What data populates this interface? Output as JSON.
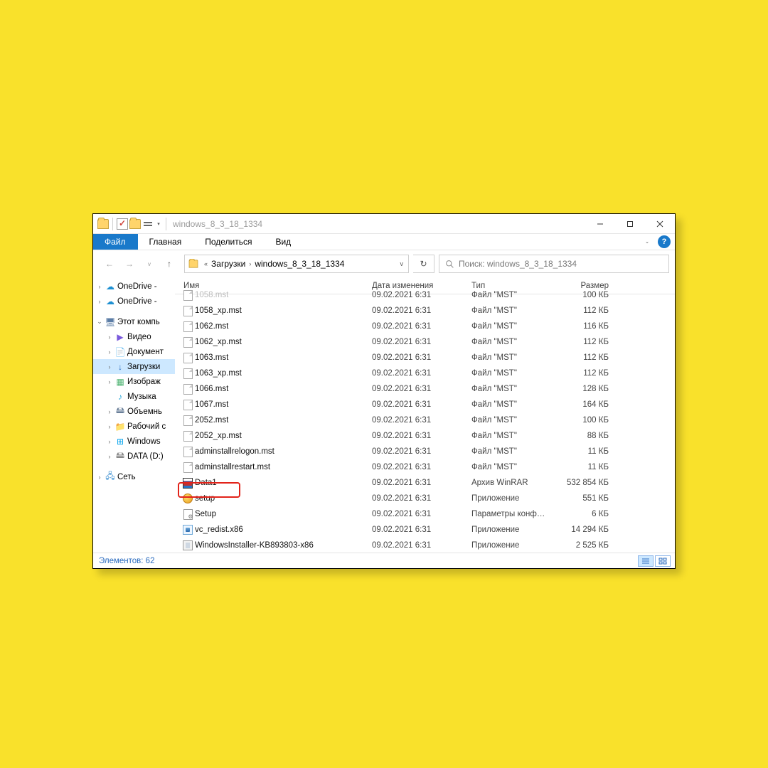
{
  "window": {
    "title": "windows_8_3_18_1334"
  },
  "tabs": {
    "file": "Файл",
    "home": "Главная",
    "share": "Поделиться",
    "view": "Вид"
  },
  "address": {
    "chev": "«",
    "seg1": "Загрузки",
    "seg2": "windows_8_3_18_1334"
  },
  "search": {
    "placeholder": "Поиск: windows_8_3_18_1334"
  },
  "columns": {
    "name": "Имя",
    "date": "Дата изменения",
    "type": "Тип",
    "size": "Размер"
  },
  "sidebar": [
    {
      "label": "OneDrive -",
      "icon": "onedrive",
      "chev": ">",
      "indent": 0
    },
    {
      "label": "OneDrive -",
      "icon": "onedrive",
      "chev": ">",
      "indent": 0
    },
    {
      "label": "Этот компь",
      "icon": "pc",
      "chev": "v",
      "indent": 0
    },
    {
      "label": "Видео",
      "icon": "vid",
      "chev": ">",
      "indent": 1
    },
    {
      "label": "Документ",
      "icon": "doc",
      "chev": ">",
      "indent": 1
    },
    {
      "label": "Загрузки",
      "icon": "arrow",
      "chev": ">",
      "indent": 1,
      "selected": true
    },
    {
      "label": "Изображ",
      "icon": "img",
      "chev": ">",
      "indent": 1
    },
    {
      "label": "Музыка",
      "icon": "music",
      "chev": "",
      "indent": 1
    },
    {
      "label": "Объемнь",
      "icon": "vol",
      "chev": ">",
      "indent": 1
    },
    {
      "label": "Рабочий с",
      "icon": "folder",
      "chev": ">",
      "indent": 1
    },
    {
      "label": "Windows",
      "icon": "win",
      "chev": ">",
      "indent": 1
    },
    {
      "label": "DATA (D:)",
      "icon": "data",
      "chev": ">",
      "indent": 1
    },
    {
      "label": "Сеть",
      "icon": "net",
      "chev": ">",
      "indent": 0
    }
  ],
  "files": [
    {
      "name": "1058.mst",
      "date": "09.02.2021 6:31",
      "type": "Файл \"MST\"",
      "size": "100 КБ",
      "icon": "doc",
      "faded": true
    },
    {
      "name": "1058_xp.mst",
      "date": "09.02.2021 6:31",
      "type": "Файл \"MST\"",
      "size": "112 КБ",
      "icon": "doc"
    },
    {
      "name": "1062.mst",
      "date": "09.02.2021 6:31",
      "type": "Файл \"MST\"",
      "size": "116 КБ",
      "icon": "doc"
    },
    {
      "name": "1062_xp.mst",
      "date": "09.02.2021 6:31",
      "type": "Файл \"MST\"",
      "size": "112 КБ",
      "icon": "doc"
    },
    {
      "name": "1063.mst",
      "date": "09.02.2021 6:31",
      "type": "Файл \"MST\"",
      "size": "112 КБ",
      "icon": "doc"
    },
    {
      "name": "1063_xp.mst",
      "date": "09.02.2021 6:31",
      "type": "Файл \"MST\"",
      "size": "112 КБ",
      "icon": "doc"
    },
    {
      "name": "1066.mst",
      "date": "09.02.2021 6:31",
      "type": "Файл \"MST\"",
      "size": "128 КБ",
      "icon": "doc"
    },
    {
      "name": "1067.mst",
      "date": "09.02.2021 6:31",
      "type": "Файл \"MST\"",
      "size": "164 КБ",
      "icon": "doc"
    },
    {
      "name": "2052.mst",
      "date": "09.02.2021 6:31",
      "type": "Файл \"MST\"",
      "size": "100 КБ",
      "icon": "doc"
    },
    {
      "name": "2052_xp.mst",
      "date": "09.02.2021 6:31",
      "type": "Файл \"MST\"",
      "size": "88 КБ",
      "icon": "doc"
    },
    {
      "name": "adminstallrelogon.mst",
      "date": "09.02.2021 6:31",
      "type": "Файл \"MST\"",
      "size": "11 КБ",
      "icon": "doc"
    },
    {
      "name": "adminstallrestart.mst",
      "date": "09.02.2021 6:31",
      "type": "Файл \"MST\"",
      "size": "11 КБ",
      "icon": "doc"
    },
    {
      "name": "Data1",
      "date": "09.02.2021 6:31",
      "type": "Архив WinRAR",
      "size": "532 854 КБ",
      "icon": "rar"
    },
    {
      "name": "setup",
      "date": "09.02.2021 6:31",
      "type": "Приложение",
      "size": "551 КБ",
      "icon": "setup",
      "highlight": true
    },
    {
      "name": "Setup",
      "date": "09.02.2021 6:31",
      "type": "Параметры конф…",
      "size": "6 КБ",
      "icon": "ini"
    },
    {
      "name": "vc_redist.x86",
      "date": "09.02.2021 6:31",
      "type": "Приложение",
      "size": "14 294 КБ",
      "icon": "exe"
    },
    {
      "name": "WindowsInstaller-KB893803-x86",
      "date": "09.02.2021 6:31",
      "type": "Приложение",
      "size": "2 525 КБ",
      "icon": "exe2"
    }
  ],
  "status": {
    "count": "Элементов: 62"
  }
}
